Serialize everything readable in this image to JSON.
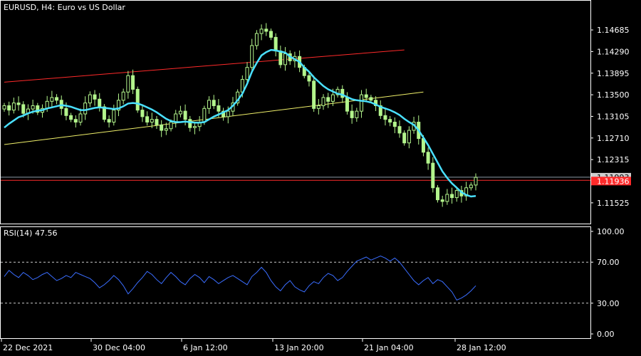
{
  "chart_data": [
    {
      "type": "candlestick",
      "title": "EURUSD, H4:  Euro vs US Dollar",
      "y_ticks": [
        "1.14685",
        "1.14290",
        "1.13895",
        "1.13500",
        "1.13105",
        "1.12710",
        "1.12315",
        "1.11525"
      ],
      "ylim": [
        1.1125,
        1.1505
      ],
      "x_ticks": [
        "22 Dec 2021",
        "30 Dec 04:00",
        "6 Jan 12:00",
        "13 Jan 20:00",
        "21 Jan 04:00",
        "28 Jan 12:00"
      ],
      "bid_price": "1.11993",
      "bid_value": 1.11993,
      "horizontal_line_label": "1.11936",
      "horizontal_line_value": 1.11936,
      "close": [
        1.133,
        1.1322,
        1.1335,
        1.1332,
        1.1316,
        1.1324,
        1.133,
        1.1318,
        1.1325,
        1.1338,
        1.1345,
        1.134,
        1.1325,
        1.1312,
        1.1305,
        1.13,
        1.1315,
        1.1335,
        1.135,
        1.1342,
        1.1328,
        1.1305,
        1.13,
        1.1322,
        1.134,
        1.1355,
        1.1385,
        1.136,
        1.1322,
        1.131,
        1.13,
        1.1305,
        1.1295,
        1.1285,
        1.1288,
        1.13,
        1.1315,
        1.132,
        1.1305,
        1.129,
        1.1292,
        1.13,
        1.1325,
        1.134,
        1.133,
        1.132,
        1.131,
        1.132,
        1.1335,
        1.1355,
        1.1378,
        1.14,
        1.144,
        1.1462,
        1.147,
        1.1466,
        1.1455,
        1.143,
        1.1405,
        1.1425,
        1.1412,
        1.142,
        1.14,
        1.1385,
        1.1375,
        1.1325,
        1.133,
        1.1345,
        1.1338,
        1.135,
        1.136,
        1.1345,
        1.132,
        1.1308,
        1.132,
        1.135,
        1.1345,
        1.134,
        1.133,
        1.1312,
        1.1305,
        1.13,
        1.1292,
        1.128,
        1.1262,
        1.1285,
        1.13,
        1.127,
        1.1245,
        1.1225,
        1.118,
        1.1158,
        1.1155,
        1.1168,
        1.1162,
        1.1175,
        1.1165,
        1.118,
        1.1185,
        1.1199
      ],
      "moving_average": [
        1.129,
        1.1297,
        1.1303,
        1.1309,
        1.1312,
        1.1316,
        1.1319,
        1.1321,
        1.1322,
        1.1325,
        1.1327,
        1.1329,
        1.1331,
        1.133,
        1.1328,
        1.1325,
        1.1322,
        1.1322,
        1.1324,
        1.1326,
        1.1327,
        1.1326,
        1.1325,
        1.1324,
        1.1325,
        1.1329,
        1.1334,
        1.1335,
        1.1334,
        1.1331,
        1.1327,
        1.1323,
        1.1318,
        1.1312,
        1.1306,
        1.1302,
        1.13,
        1.13,
        1.1301,
        1.13,
        1.1299,
        1.1299,
        1.13,
        1.1305,
        1.131,
        1.1314,
        1.1318,
        1.1322,
        1.133,
        1.134,
        1.1352,
        1.137,
        1.1392,
        1.1408,
        1.1422,
        1.1428,
        1.1432,
        1.1431,
        1.1429,
        1.1427,
        1.142,
        1.1415,
        1.141,
        1.14,
        1.1392,
        1.1382,
        1.1374,
        1.1366,
        1.136,
        1.1356,
        1.1352,
        1.135,
        1.1346,
        1.1342,
        1.134,
        1.1339,
        1.1338,
        1.1336,
        1.1332,
        1.1328,
        1.1325,
        1.1322,
        1.1318,
        1.1313,
        1.1306,
        1.13,
        1.1295,
        1.1285,
        1.1272,
        1.1258,
        1.1242,
        1.1226,
        1.121,
        1.1198,
        1.1188,
        1.118,
        1.1172,
        1.1167,
        1.1164,
        1.1165
      ],
      "trendlines": [
        {
          "color": "#ff2a2a",
          "from": [
            0,
            1.1373
          ],
          "to": [
            84,
            1.1432
          ]
        },
        {
          "color": "#f0f06a",
          "from": [
            0,
            1.1259
          ],
          "to": [
            88,
            1.1355
          ]
        }
      ],
      "colors": {
        "candle": "#b3f58c",
        "moving_average": "#4ae0ff",
        "bid_line": "#8c9aa6",
        "horizontal_line": "#ff2a2a",
        "bid_label_bg": "#cfcfcf",
        "horizontal_label_bg": "#ff2a2a",
        "grid_frame": "#ffffff"
      }
    },
    {
      "type": "line",
      "title": "RSI(14) 47.56",
      "y_ticks": [
        "100.00",
        "70.00",
        "30.00",
        "0.00"
      ],
      "ylim": [
        0,
        100
      ],
      "levels": [
        70,
        30
      ],
      "values": [
        56,
        62,
        58,
        55,
        60,
        57,
        53,
        55,
        58,
        60,
        56,
        52,
        54,
        57,
        55,
        60,
        58,
        56,
        54,
        50,
        45,
        48,
        52,
        57,
        53,
        47,
        39,
        44,
        50,
        55,
        61,
        58,
        53,
        49,
        55,
        60,
        56,
        51,
        48,
        54,
        58,
        55,
        50,
        56,
        53,
        49,
        52,
        55,
        57,
        54,
        51,
        48,
        56,
        60,
        65,
        60,
        52,
        46,
        42,
        48,
        52,
        46,
        43,
        41,
        47,
        51,
        49,
        55,
        59,
        57,
        52,
        55,
        61,
        66,
        71,
        73,
        75,
        72,
        74,
        76,
        74,
        71,
        74,
        70,
        64,
        58,
        52,
        48,
        52,
        55,
        49,
        53,
        51,
        46,
        41,
        33,
        35,
        38,
        42,
        47
      ],
      "color": "#3a6dff"
    }
  ]
}
